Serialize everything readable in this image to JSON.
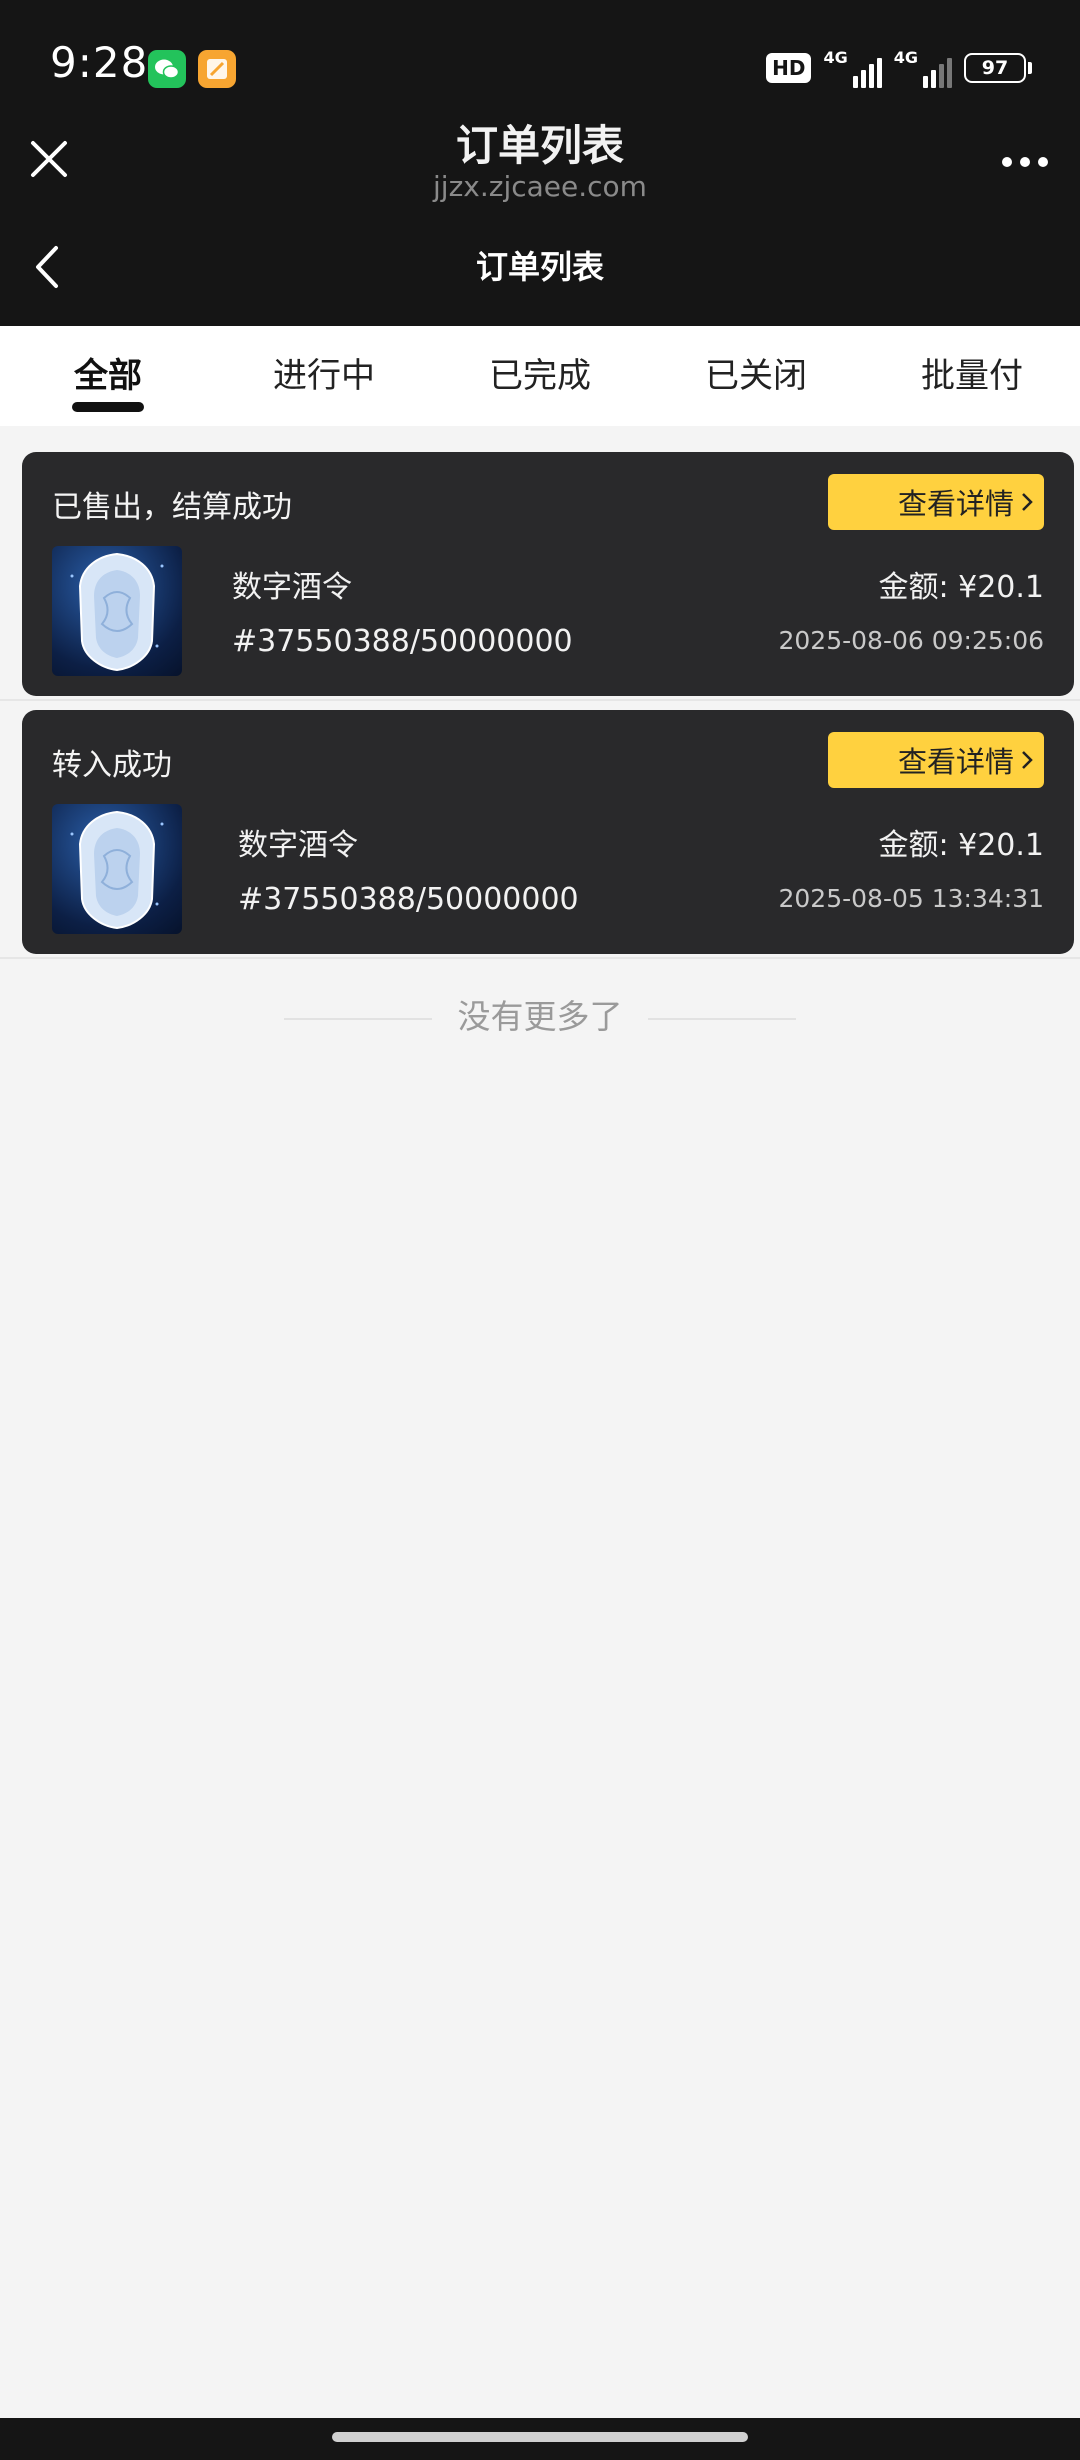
{
  "status_bar": {
    "time": "9:28",
    "apps": [
      "wechat-icon",
      "files-icon"
    ],
    "hd_badge": "HD",
    "network_labels": [
      "4G",
      "4G"
    ],
    "battery": "97"
  },
  "title_bar": {
    "title": "订单列表",
    "url": "jjzx.zjcaee.com",
    "close_icon": "close-icon",
    "more_icon": "more-icon"
  },
  "nav": {
    "title": "订单列表",
    "back_icon": "back-icon"
  },
  "tabs": [
    {
      "label": "全部",
      "active": true
    },
    {
      "label": "进行中",
      "active": false
    },
    {
      "label": "已完成",
      "active": false
    },
    {
      "label": "已关闭",
      "active": false
    },
    {
      "label": "批量付",
      "active": false
    }
  ],
  "orders": [
    {
      "status": "已售出，结算成功",
      "detail_label": "查看详情",
      "name": "数字酒令",
      "serial": "#37550388/50000000",
      "amount": "金额: ¥20.1",
      "time": "2025-08-06 09:25:06"
    },
    {
      "status": "转入成功",
      "detail_label": "查看详情",
      "name": "数字酒令",
      "serial": "#37550388/50000000",
      "amount": "金额: ¥20.1",
      "time": "2025-08-05 13:34:31"
    }
  ],
  "footer": {
    "no_more": "没有更多了"
  },
  "colors": {
    "accent": "#ffd13f",
    "header_bg": "#151515",
    "card_bg": "#29292b",
    "page_bg": "#f4f4f4"
  }
}
